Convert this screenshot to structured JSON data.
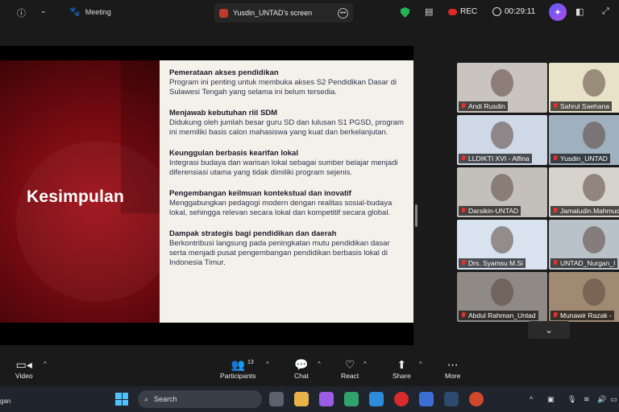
{
  "topbar": {
    "meeting_label": "Meeting",
    "share_label": "Yusdin_UNTAD's screen",
    "rec_label": "REC",
    "timer": "00:29:11"
  },
  "slide": {
    "title": "Kesimpulan",
    "points": [
      {
        "heading": "Pemerataan akses pendidikan",
        "body": "Program ini penting untuk membuka akses S2 Pendidikan Dasar di Sulawesi Tengah yang selama ini belum tersedia."
      },
      {
        "heading": "Menjawab kebutuhan riil SDM",
        "body": "Didukung oleh jumlah besar guru SD dan lulusan S1 PGSD, program ini memiliki basis calon mahasiswa yang kuat dan berkelanjutan."
      },
      {
        "heading": "Keunggulan berbasis kearifan lokal",
        "body": "Integrasi budaya dan warisan lokal sebagai sumber belajar menjadi diferensiasi utama yang tidak dimiliki program sejenis."
      },
      {
        "heading": "Pengembangan keilmuan kontekstual dan inovatif",
        "body": "Menggabungkan pedagogi modern dengan realitas sosial-budaya lokal, sehingga relevan secara lokal dan kompetitif secara global."
      },
      {
        "heading": "Dampak strategis bagi pendidikan dan daerah",
        "body": "Berkontribusi langsung pada peningkatan mutu pendidikan dasar serta menjadi pusat pengembangan pendidikan berbasis lokal di Indonesia Timur."
      }
    ]
  },
  "participants": [
    {
      "name": "Andi Rusdin",
      "bg": "#c9c4bd"
    },
    {
      "name": "Sahrul Saehana",
      "bg": "#e7e2c8"
    },
    {
      "name": "LLDIKTI XVI - Alfina",
      "bg": "#cfd8e6"
    },
    {
      "name": "Yusdin_UNTAD",
      "bg": "#9fb0bf"
    },
    {
      "name": "Darsikin-UNTAD",
      "bg": "#c3c0bb"
    },
    {
      "name": "Jamaludin.Mahmud",
      "bg": "#d6d2cc"
    },
    {
      "name": "Drs. Syamsu M.Si",
      "bg": "#d8e3ef"
    },
    {
      "name": "UNTAD_Nurgan_I",
      "bg": "#b9c2c9"
    },
    {
      "name": "Abdul Rahman_Untad",
      "bg": "#8f8a85"
    },
    {
      "name": "Munawir Razak -",
      "bg": "#a08a74"
    }
  ],
  "toolbar": {
    "video_label": "Video",
    "participants_label": "Participants",
    "participants_count": "13",
    "chat_label": "Chat",
    "react_label": "React",
    "share_label": "Share",
    "more_label": "More"
  },
  "taskbar": {
    "left_text": "gan",
    "search_placeholder": "Search"
  },
  "colors": {
    "slide_red": "#8b0d14",
    "slide_panel": "#f4f1ea",
    "rec_red": "#e02828",
    "shield_green": "#21b354"
  }
}
